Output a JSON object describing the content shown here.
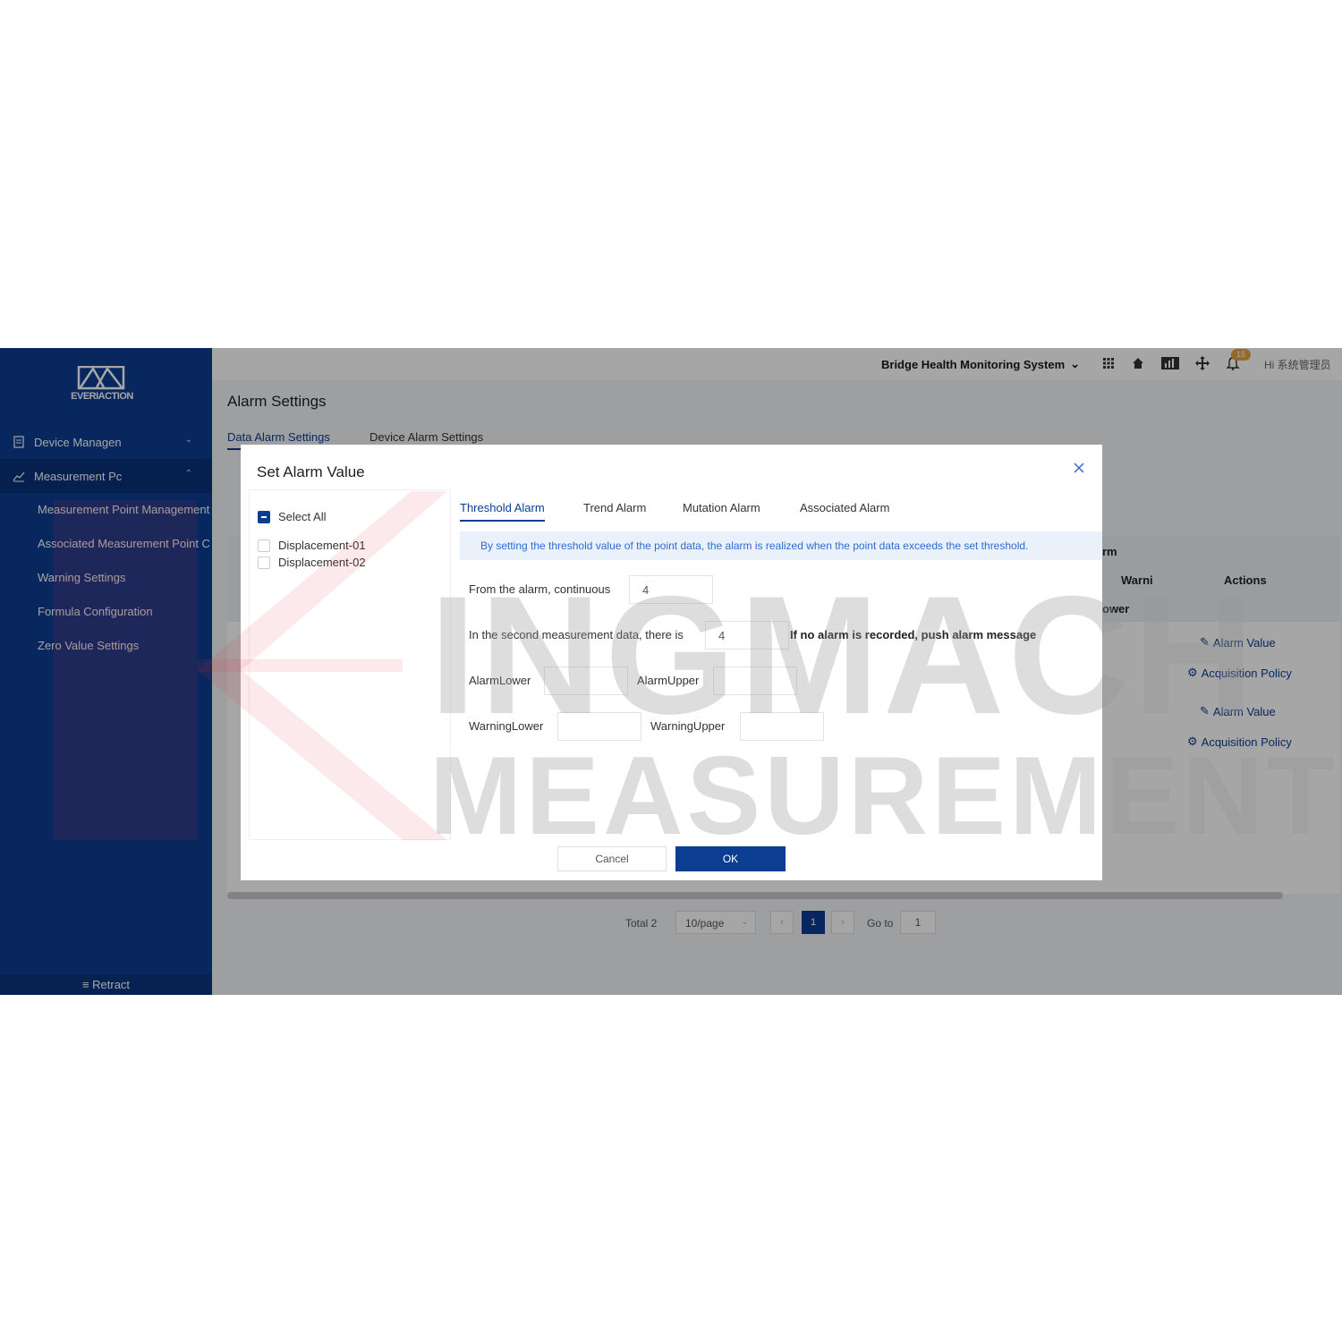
{
  "brand": {
    "logo_text": "EVERIACTION"
  },
  "sidebar": {
    "groups": [
      {
        "label": "Device Managen",
        "icon": "document-icon"
      },
      {
        "label": "Measurement Pc",
        "icon": "line-chart-icon"
      }
    ],
    "submenu": [
      "Measurement Point Management",
      "Associated Measurement Point C",
      "Warning Settings",
      "Formula Configuration",
      "Zero Value Settings"
    ],
    "retract": "≡ Retract"
  },
  "header": {
    "system": "Bridge Health Monitoring System",
    "badge": "15",
    "greeting": "Hi 系统管理员"
  },
  "page": {
    "title": "Alarm Settings",
    "tabs": [
      "Data Alarm Settings",
      "Device Alarm Settings"
    ]
  },
  "background_table": {
    "col_alarm": "rm",
    "col_warning": "Warni",
    "col_lower": "ower",
    "col_actions": "Actions",
    "actions": [
      "Alarm Value",
      "Acquisition Policy",
      "Alarm Value",
      "Acquisition Policy"
    ]
  },
  "pagination": {
    "total": "Total 2",
    "page_size": "10/page",
    "current": "1",
    "goto_label": "Go to",
    "goto_value": "1"
  },
  "modal": {
    "title": "Set Alarm Value",
    "select_all": "Select All",
    "points": [
      "Displacement-01",
      "Displacement-02"
    ],
    "tabs": [
      "Threshold Alarm",
      "Trend Alarm",
      "Mutation Alarm",
      "Associated Alarm"
    ],
    "info": "By setting the threshold value of the point data, the alarm is realized when the point data exceeds the set threshold.",
    "from_label": "From the alarm, continuous",
    "continuous_value": "4",
    "second_label": "In the second measurement data, there is",
    "second_value": "4",
    "push_label": "If no alarm is recorded, push alarm message",
    "alarm_lower_label": "AlarmLower",
    "alarm_upper_label": "AlarmUpper",
    "warning_lower_label": "WarningLower",
    "warning_upper_label": "WarningUpper",
    "cancel": "Cancel",
    "ok": "OK"
  },
  "watermark": [
    "INGMACH",
    "MEASUREMENT"
  ],
  "colors": {
    "primary": "#0b3d91",
    "badge": "#e6a23c",
    "info_bg": "#eaf1fb",
    "info_text": "#2f6bd0"
  }
}
